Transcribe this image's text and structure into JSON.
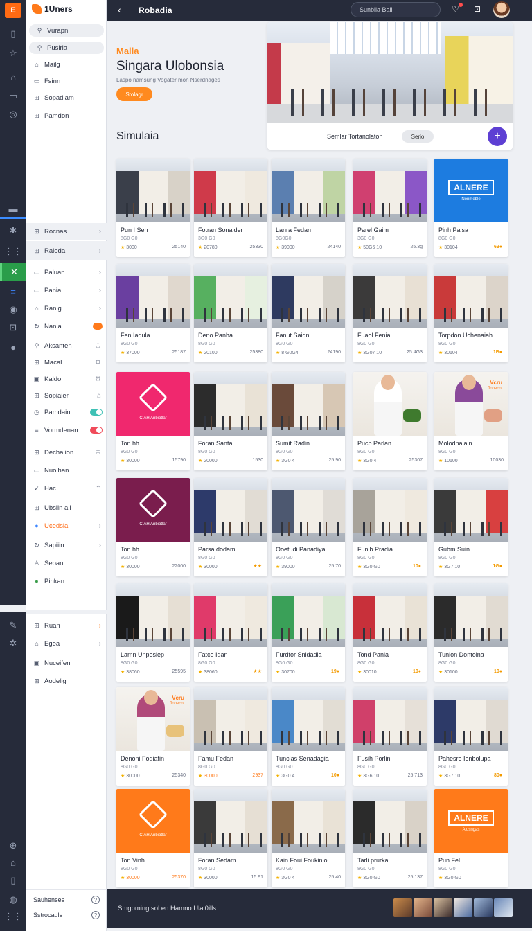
{
  "app": {
    "brand_name": "1Uners",
    "rail_logo": "E"
  },
  "topbar": {
    "title": "Robadia",
    "search_value": "Sunbila Bali"
  },
  "sidebar": {
    "top_items": [
      {
        "label": "Vurapn",
        "icon": "search-icon"
      },
      {
        "label": "Pusiria",
        "icon": "search-icon"
      },
      {
        "label": "Mailg",
        "icon": "bag-icon"
      },
      {
        "label": "Fsinn",
        "icon": "card-icon"
      },
      {
        "label": "Sopadiam",
        "icon": "grid-icon"
      },
      {
        "label": "Pamdon",
        "icon": "grid-icon"
      }
    ],
    "group_a": [
      {
        "label": "Rocnas"
      },
      {
        "label": "Raloda"
      }
    ],
    "group_b": [
      {
        "label": "Paluan"
      },
      {
        "label": "Pania"
      },
      {
        "label": "Ranig"
      },
      {
        "label": "Nania"
      }
    ],
    "group_c": [
      {
        "label": "Aksanten"
      },
      {
        "label": "Macal"
      },
      {
        "label": "Kaldo"
      },
      {
        "label": "Sopiaier"
      },
      {
        "label": "Pamdain"
      },
      {
        "label": "Vormdenan"
      }
    ],
    "group_d": [
      {
        "label": "Dechalion"
      },
      {
        "label": "Nuolhan"
      },
      {
        "label": "Hac"
      },
      {
        "label": "Ubsiin ail"
      },
      {
        "label": "Ucedsia"
      },
      {
        "label": "Sapiiin"
      },
      {
        "label": "Seoan"
      },
      {
        "label": "Pinkan"
      }
    ],
    "group_e": [
      {
        "label": "Ruan"
      },
      {
        "label": "Egea"
      },
      {
        "label": "Nuceifen"
      },
      {
        "label": "Aodelig"
      }
    ],
    "bottom": [
      {
        "label": "Sauhenses"
      },
      {
        "label": "Sstrocadls"
      }
    ]
  },
  "hero": {
    "kicker": "Malla",
    "title": "Singara Ulobonsia",
    "subtitle": "Laspo namsung Vogater mon Nserdnages",
    "button": "Stolagr",
    "footer_text": "Semlar Tortanolaton",
    "chip": "Serio"
  },
  "section": {
    "title": "Simulaia"
  },
  "cards": [
    {
      "title": "Pun I Seh",
      "sub": "8G0 G0",
      "rating": "3000",
      "value": "25140",
      "kind": "mall",
      "c1": "#3a3f4a",
      "c2": "#d8d2c8"
    },
    {
      "title": "Fotran Sonalder",
      "sub": "3G0 G0",
      "rating": "20780",
      "value": "25330",
      "kind": "mall",
      "c1": "#cf3a4a",
      "c2": "#efe9df"
    },
    {
      "title": "Lanra Fedan",
      "sub": "8G0G0",
      "rating": "39000",
      "value": "24140",
      "kind": "mall",
      "c1": "#5b7fb0",
      "c2": "#bfd4a4"
    },
    {
      "title": "Parel Gaim",
      "sub": "3G0 G0",
      "rating": "50G6 10",
      "value": "25.3g",
      "kind": "mall",
      "c1": "#d04070",
      "c2": "#8b57c7"
    },
    {
      "title": "Pinh Paisa",
      "sub": "8G0 G0",
      "rating": "30104",
      "value": "63",
      "kind": "alure",
      "bg": "#1d7ce0",
      "badge": true
    },
    {
      "title": "Fen Iadula",
      "sub": "8G0 G0",
      "rating": "37000",
      "value": "25187",
      "kind": "mall",
      "c1": "#6a3fa0",
      "c2": "#e0d8ce"
    },
    {
      "title": "Deno Panha",
      "sub": "8G0 G0",
      "rating": "20100",
      "value": "25380",
      "kind": "mall",
      "c1": "#57b060",
      "c2": "#e6f0e0"
    },
    {
      "title": "Fanut Saidn",
      "sub": "8G0 G0",
      "rating": "8 G0G4",
      "value": "24190",
      "kind": "mall",
      "c1": "#2e3a60",
      "c2": "#d6d2ca"
    },
    {
      "title": "Fuaol Fenia",
      "sub": "8G0 G0",
      "rating": "3G07 10",
      "value": "25.4G3",
      "kind": "mall",
      "c1": "#3b3a3a",
      "c2": "#e8e0d4"
    },
    {
      "title": "Torpdon Uchenaiah",
      "sub": "8G0 G0",
      "rating": "30104",
      "value": "1B",
      "kind": "mall",
      "c1": "#c93a3a",
      "c2": "#dcd4ca",
      "badge": true
    },
    {
      "title": "Ton hh",
      "sub": "8G0 G0",
      "rating": "30000",
      "value": "15790",
      "kind": "brand",
      "bg": "#f0286e"
    },
    {
      "title": "Foran Santa",
      "sub": "8G0 G0",
      "rating": "20000",
      "value": "1530",
      "kind": "mall",
      "c1": "#2c2c2c",
      "c2": "#e9e2d6"
    },
    {
      "title": "Sumit Radin",
      "sub": "8G0 G0",
      "rating": "3G0 4",
      "value": "25.90",
      "kind": "mall",
      "c1": "#6a4a3a",
      "c2": "#d7c7b4"
    },
    {
      "title": "Pucb Parlan",
      "sub": "8G0 G0",
      "rating": "3G0 4",
      "value": "25307",
      "kind": "person",
      "p1": "#ffffff",
      "pp": "#3f7a2e"
    },
    {
      "title": "Molodnalain",
      "sub": "8G0 G0",
      "rating": "10100",
      "value": "10030",
      "kind": "person-hijab",
      "p1": "#8a4a9a",
      "pp": "#e1a084",
      "vcap1": "Vcru",
      "vcap2": "Tobecol"
    },
    {
      "title": "Ton hh",
      "sub": "8G0 G0",
      "rating": "30000",
      "value": "22000",
      "kind": "brand",
      "bg": "#7a1d4d"
    },
    {
      "title": "Parsa dodam",
      "sub": "8G0 G0",
      "rating": "30000",
      "value": "",
      "kind": "mall",
      "c1": "#2d3a6a",
      "c2": "#e1dcd4",
      "stars": true
    },
    {
      "title": "Ooetudi Panadiya",
      "sub": "8G0 G0",
      "rating": "39000",
      "value": "25.70",
      "kind": "mall",
      "c1": "#4d5870",
      "c2": "#e0dcd6"
    },
    {
      "title": "Funib Pradia",
      "sub": "8G0 G0",
      "rating": "3G0 G0",
      "value": "10",
      "kind": "mall",
      "c1": "#a8a39a",
      "c2": "#efe9df",
      "badge": true
    },
    {
      "title": "Gubm Suin",
      "sub": "8G0 G0",
      "rating": "3G7 10",
      "value": "1G",
      "kind": "mall",
      "c1": "#3a3a3a",
      "c2": "#d84040",
      "badge": true
    },
    {
      "title": "Lamn Unpesiep",
      "sub": "8G0 G0",
      "rating": "38060",
      "value": "25595",
      "kind": "mall",
      "c1": "#1a1a1a",
      "c2": "#e6dfd4"
    },
    {
      "title": "Fatce Idan",
      "sub": "8G0 G0",
      "rating": "38060",
      "value": "",
      "kind": "mall",
      "c1": "#e03a6a",
      "c2": "#efe9df",
      "stars": true
    },
    {
      "title": "Furdfor Snidadia",
      "sub": "8G0 G0",
      "rating": "30700",
      "value": "19",
      "kind": "mall",
      "c1": "#3aa058",
      "c2": "#d8e8d2",
      "badge": true
    },
    {
      "title": "Tond Panla",
      "sub": "8G0 G0",
      "rating": "30010",
      "value": "10",
      "kind": "mall",
      "c1": "#c8303a",
      "c2": "#e9e2d6",
      "badge": true
    },
    {
      "title": "Tunion Dontoina",
      "sub": "8G0 G0",
      "rating": "30100",
      "value": "10",
      "kind": "mall",
      "c1": "#2b2b2b",
      "c2": "#e1dbd2",
      "badge": true
    },
    {
      "title": "Denoni Fodiafin",
      "sub": "8G0 G0",
      "rating": "30000",
      "value": "25340",
      "kind": "person-hijab",
      "p1": "#b04a7a",
      "pp": "#e8c27a",
      "vcap1": "Vcru",
      "vcap2": "Tobecol"
    },
    {
      "title": "Famu Fedan",
      "sub": "8G0 G0",
      "rating": "30000",
      "value": "2937",
      "kind": "mall",
      "c1": "#c9c0b2",
      "c2": "#efe9df",
      "orange": true
    },
    {
      "title": "Tunclas Senadagia",
      "sub": "8G0 G0",
      "rating": "3G0 4",
      "value": "10",
      "kind": "mall",
      "c1": "#4a88c8",
      "c2": "#e2ddd4",
      "badge": true
    },
    {
      "title": "Fusih Porlin",
      "sub": "8G0 G0",
      "rating": "3G6 10",
      "value": "25.713",
      "kind": "mall",
      "c1": "#d0406a",
      "c2": "#e6e0d8"
    },
    {
      "title": "Pahesre Ienbolupa",
      "sub": "8G0 G0",
      "rating": "3G7 10",
      "value": "80",
      "kind": "mall",
      "c1": "#2d3a68",
      "c2": "#e0dad2",
      "badge": true
    },
    {
      "title": "Ton Vinh",
      "sub": "8G0 G0",
      "rating": "30000",
      "value": "25370",
      "kind": "brand",
      "bg": "#ff7a1a",
      "orange": true
    },
    {
      "title": "Foran Sedam",
      "sub": "8G0 G0",
      "rating": "30000",
      "value": "15.91",
      "kind": "mall",
      "c1": "#3a3a3a",
      "c2": "#e6dfd4"
    },
    {
      "title": "Kain Foui Foukinio",
      "sub": "8G0 G0",
      "rating": "3G0 4",
      "value": "25.40",
      "kind": "mall",
      "c1": "#8a6a4a",
      "c2": "#e9e2d6"
    },
    {
      "title": "Tarli prurka",
      "sub": "8G0 G0",
      "rating": "3G0 G0",
      "value": "25.137",
      "kind": "mall",
      "c1": "#2b2b2b",
      "c2": "#d9d2c8"
    },
    {
      "title": "Pun Fel",
      "sub": "8G0 G0",
      "rating": "3G0 G0",
      "value": "",
      "kind": "alure",
      "bg": "#ff7a1a",
      "alure_text": "ALNERE",
      "alure_cap": "Alusngas"
    }
  ],
  "alure": {
    "text": "ALNERE",
    "cap": "Nonmeble"
  },
  "brand_tile": {
    "cap": "CIAH Anbibtlar"
  },
  "bottombar": {
    "text": "Smgpming sol en Hamno Ulal0ills"
  },
  "colors": {
    "accent": "#ff7a1a",
    "dark": "#262b3a",
    "purple": "#5d3fd3"
  }
}
